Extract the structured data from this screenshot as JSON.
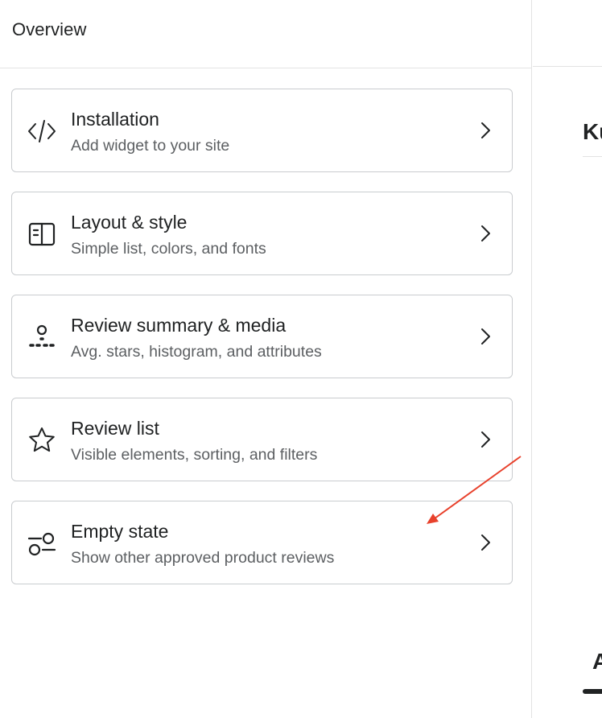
{
  "header": {
    "title": "Overview"
  },
  "cards": [
    {
      "icon": "code-icon",
      "title": "Installation",
      "description": "Add widget to your site"
    },
    {
      "icon": "layout-icon",
      "title": "Layout & style",
      "description": "Simple list, colors, and fonts"
    },
    {
      "icon": "summary-icon",
      "title": "Review summary & media",
      "description": "Avg. stars, histogram, and attributes"
    },
    {
      "icon": "star-icon",
      "title": "Review list",
      "description": "Visible elements, sorting, and filters"
    },
    {
      "icon": "empty-state-icon",
      "title": "Empty state",
      "description": "Show other approved product reviews"
    }
  ],
  "right_panel": {
    "title_fragment": "Ku",
    "tab_fragment": "A"
  },
  "colors": {
    "border": "#c9cccf",
    "text": "#202223",
    "subdued": "#5c5f62",
    "annotation": "#e8412c"
  }
}
